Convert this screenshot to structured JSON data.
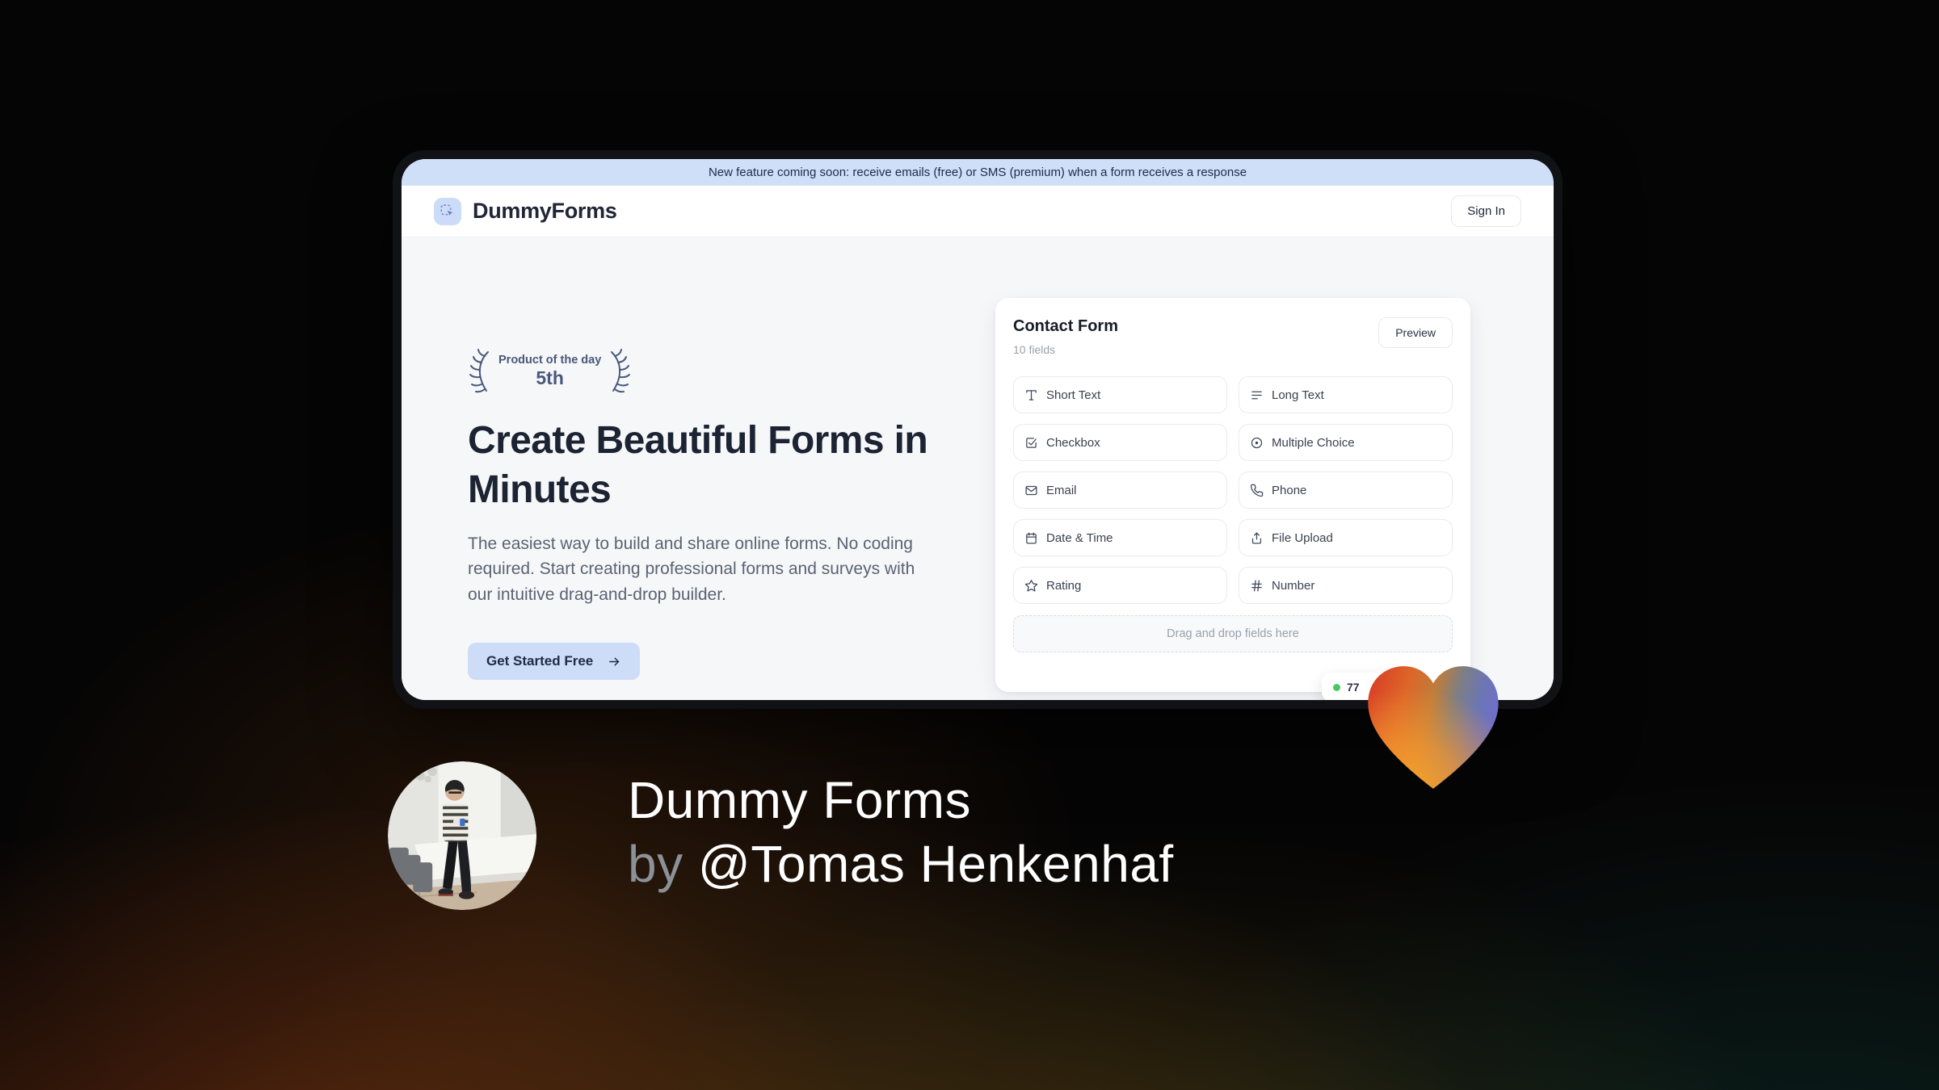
{
  "banner": {
    "text": "New feature coming soon: receive emails (free) or SMS (premium) when a form receives a response"
  },
  "header": {
    "brand": "DummyForms",
    "sign_in_label": "Sign In"
  },
  "hero": {
    "award_badge": {
      "line1": "Product of the day",
      "line2": "5th"
    },
    "title": "Create Beautiful Forms in Minutes",
    "description": "The easiest way to build and share online forms. No coding required. Start creating professional forms and surveys with our intuitive drag-and-drop builder.",
    "cta_label": "Get Started Free"
  },
  "form_card": {
    "title": "Contact Form",
    "subtitle": "10 fields",
    "preview_label": "Preview",
    "fields": [
      {
        "label": "Short Text",
        "icon": "short-text-icon"
      },
      {
        "label": "Long Text",
        "icon": "long-text-icon"
      },
      {
        "label": "Checkbox",
        "icon": "checkbox-icon"
      },
      {
        "label": "Multiple Choice",
        "icon": "multiple-choice-icon"
      },
      {
        "label": "Email",
        "icon": "email-icon"
      },
      {
        "label": "Phone",
        "icon": "phone-icon"
      },
      {
        "label": "Date & Time",
        "icon": "calendar-icon"
      },
      {
        "label": "File Upload",
        "icon": "upload-icon"
      },
      {
        "label": "Rating",
        "icon": "star-icon"
      },
      {
        "label": "Number",
        "icon": "hash-icon"
      }
    ],
    "dropzone_text": "Drag and drop fields here",
    "response_badge": {
      "text": "77"
    }
  },
  "footer": {
    "title": "Dummy Forms",
    "byline_prefix": "by ",
    "author": "@Tomas Henkenhaf"
  },
  "colors": {
    "accent_blue": "#cdddf8",
    "banner_bg": "#cfdff8",
    "navy": "#1c2433",
    "muted_text": "#5a6372",
    "card_border": "#e9ebef",
    "green_dot": "#4bc664",
    "heart_red": "#d93c27",
    "heart_orange": "#f4a12f",
    "heart_blue": "#6f74c9"
  }
}
